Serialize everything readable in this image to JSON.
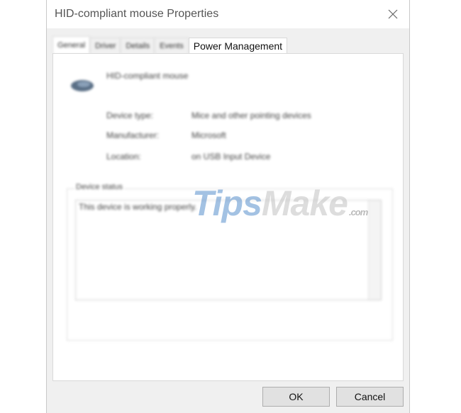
{
  "window": {
    "title": "HID-compliant mouse Properties"
  },
  "tabs": [
    {
      "label": "General",
      "selected": true
    },
    {
      "label": "Driver",
      "selected": false
    },
    {
      "label": "Details",
      "selected": false
    },
    {
      "label": "Events",
      "selected": false
    },
    {
      "label": "Power Management",
      "selected": false
    }
  ],
  "general": {
    "device_name": "HID-compliant mouse",
    "properties": [
      {
        "label": "Device type:",
        "value": "Mice and other pointing devices"
      },
      {
        "label": "Manufacturer:",
        "value": "Microsoft"
      },
      {
        "label": "Location:",
        "value": "on USB Input Device"
      }
    ],
    "status_legend": "Device status",
    "status_text": "This device is working properly."
  },
  "watermark": {
    "main": "Tips",
    "accent": "Make",
    "suffix": ".com"
  },
  "buttons": {
    "ok_label": "OK",
    "cancel_label": "Cancel"
  },
  "icons": {
    "close": "close-icon",
    "device": "mouse-icon"
  },
  "colors": {
    "window_bg": "#f0f0f0",
    "watermark_blue": "#4a86c8",
    "button_bg": "#e1e1e1"
  }
}
